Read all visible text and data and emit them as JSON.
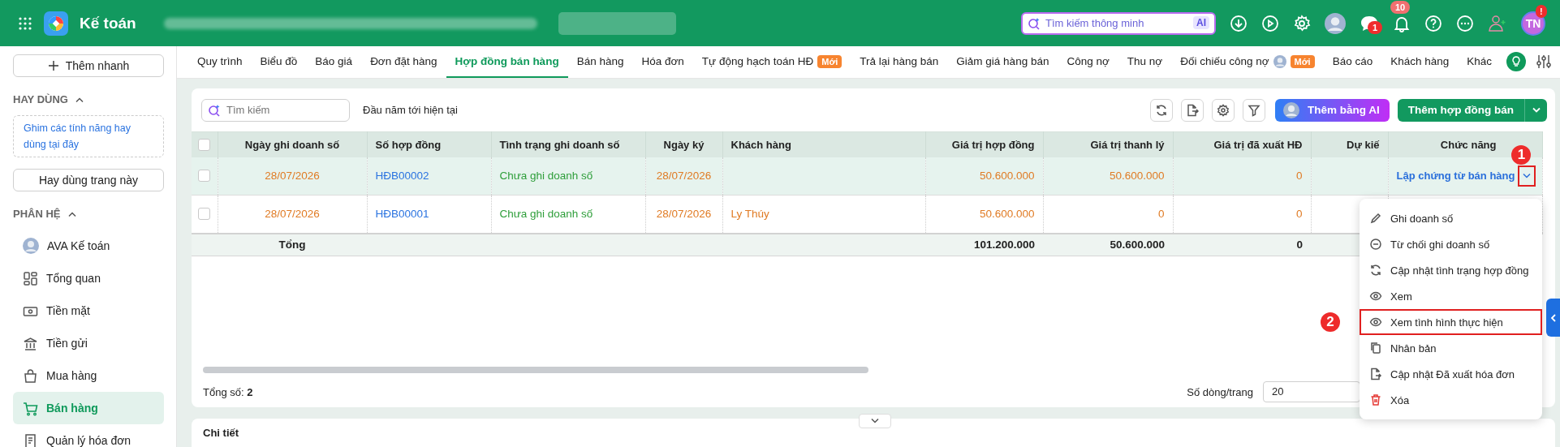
{
  "app": {
    "title": "Kế toán"
  },
  "header": {
    "search_placeholder": "Tìm kiếm thông minh",
    "ai_badge": "AI",
    "chat_badge": "1",
    "notification_badge": "10",
    "avatar_initials": "TN",
    "avatar_badge": "!"
  },
  "sidebar": {
    "quick_add": "Thêm nhanh",
    "favorites_title": "HAY DÙNG",
    "favorites_expanded": true,
    "favorites_hint": "Ghim các tính năng hay dùng tại đây",
    "favorites_button": "Hay dùng trang này",
    "modules_title": "PHÂN HỆ",
    "modules_expanded": true,
    "items": [
      {
        "label": "AVA Kế toán",
        "kind": "avatar",
        "selected": false
      },
      {
        "label": "Tổng quan",
        "kind": "dashboard",
        "selected": false
      },
      {
        "label": "Tiền mặt",
        "kind": "cash",
        "selected": false
      },
      {
        "label": "Tiền gửi",
        "kind": "bank",
        "selected": false
      },
      {
        "label": "Mua hàng",
        "kind": "purchase",
        "selected": false
      },
      {
        "label": "Bán hàng",
        "kind": "sales",
        "selected": true
      },
      {
        "label": "Quản lý hóa đơn",
        "kind": "invoice",
        "selected": false
      }
    ]
  },
  "tabs": [
    {
      "label": "Quy trình",
      "selected": false
    },
    {
      "label": "Biểu đồ",
      "selected": false
    },
    {
      "label": "Báo giá",
      "selected": false
    },
    {
      "label": "Đơn đặt hàng",
      "selected": false
    },
    {
      "label": "Hợp đồng bán hàng",
      "selected": true
    },
    {
      "label": "Bán hàng",
      "selected": false
    },
    {
      "label": "Hóa đơn",
      "selected": false
    },
    {
      "label": "Tự động hạch toán HĐ",
      "selected": false,
      "badge": "Mới"
    },
    {
      "label": "Trả lại hàng bán",
      "selected": false
    },
    {
      "label": "Giảm giá hàng bán",
      "selected": false
    },
    {
      "label": "Công nợ",
      "selected": false
    },
    {
      "label": "Thu nợ",
      "selected": false
    },
    {
      "label": "Đối chiếu công nợ",
      "selected": false,
      "kind": "avatar",
      "badge": "Mới"
    },
    {
      "label": "Báo cáo",
      "selected": false
    },
    {
      "label": "Khách hàng",
      "selected": false
    },
    {
      "label": "Khác",
      "selected": false
    }
  ],
  "toolbar": {
    "search_placeholder": "Tìm kiếm",
    "period": "Đầu năm tới hiện tại",
    "ai_button": "Thêm bằng AI",
    "add_button": "Thêm hợp đồng bán"
  },
  "table": {
    "all_selected": false,
    "columns": [
      "Ngày ghi doanh số",
      "Số hợp đồng",
      "Tình trạng ghi doanh số",
      "Ngày ký",
      "Khách hàng",
      "Giá trị hợp đồng",
      "Giá trị thanh lý",
      "Giá trị đã xuất HĐ",
      "Dự kiế",
      "Chức năng"
    ],
    "rows": [
      {
        "selected": false,
        "highlighted": true,
        "date": "28/07/2026",
        "contract_no": "HĐB00002",
        "status": "Chưa ghi doanh số",
        "signed_date": "28/07/2026",
        "contract_value": "50.600.000",
        "liquidation_value": "50.600.000",
        "invoiced_value": "0",
        "action": "Lập chứng từ bán hàng",
        "marker": "1"
      },
      {
        "selected": false,
        "highlighted": false,
        "date": "28/07/2026",
        "contract_no": "HĐB00001",
        "status": "Chưa ghi doanh số",
        "signed_date": "28/07/2026",
        "customer": "Ly Thúy",
        "contract_value": "50.600.000",
        "liquidation_value": "0",
        "invoiced_value": "0"
      }
    ],
    "total": {
      "label": "Tổng",
      "contract_value": "101.200.000",
      "liquidation_value": "50.600.000",
      "invoiced_value": "0"
    }
  },
  "footer": {
    "total_label": "Tổng số:",
    "total_value": "2",
    "page_size_label": "Số dòng/trang",
    "page_size": "20"
  },
  "detail": {
    "title": "Chi tiết",
    "expanded": false
  },
  "menu": {
    "items": [
      {
        "label": "Ghi doanh số",
        "kind": "edit"
      },
      {
        "label": "Từ chối ghi doanh số",
        "kind": "reject"
      },
      {
        "label": "Cập nhật tình trạng hợp đồng",
        "kind": "refresh"
      },
      {
        "label": "Xem",
        "kind": "view"
      },
      {
        "label": "Xem tình hình thực hiện",
        "kind": "view",
        "marker": "2"
      },
      {
        "label": "Nhân bản",
        "kind": "copy"
      },
      {
        "label": "Cập nhật Đã xuất hóa đơn",
        "kind": "export"
      },
      {
        "label": "Xóa",
        "kind": "delete"
      }
    ]
  }
}
